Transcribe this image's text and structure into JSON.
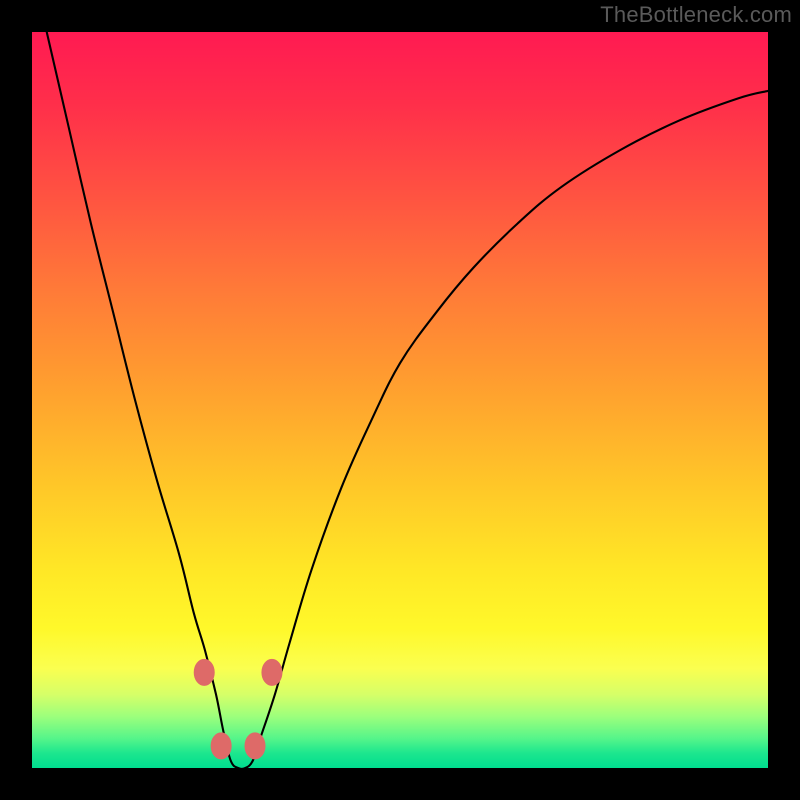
{
  "watermark": "TheBottleneck.com",
  "chart_data": {
    "type": "line",
    "title": "",
    "xlabel": "",
    "ylabel": "",
    "xlim": [
      0,
      100
    ],
    "ylim": [
      0,
      100
    ],
    "series": [
      {
        "name": "bottleneck-curve",
        "x": [
          2,
          5,
          8,
          11,
          14,
          17,
          20,
          22,
          23.5,
          25,
          26,
          27,
          28,
          29,
          30,
          31,
          33,
          35,
          38,
          42,
          46,
          50,
          55,
          60,
          66,
          72,
          80,
          88,
          96,
          100
        ],
        "values": [
          100,
          87,
          74,
          62,
          50,
          39,
          29,
          21,
          16,
          10,
          5,
          1,
          0,
          0,
          1,
          4,
          10,
          17,
          27,
          38,
          47,
          55,
          62,
          68,
          74,
          79,
          84,
          88,
          91,
          92
        ]
      }
    ],
    "annotations": [
      {
        "name": "marker-left-upper",
        "x": 23.4,
        "y": 13
      },
      {
        "name": "marker-left-lower",
        "x": 25.7,
        "y": 3
      },
      {
        "name": "marker-right-lower",
        "x": 30.3,
        "y": 3
      },
      {
        "name": "marker-right-upper",
        "x": 32.6,
        "y": 13
      }
    ],
    "background_gradient": {
      "top": "#ff1a52",
      "mid": "#ffe726",
      "bottom": "#00de8f"
    }
  }
}
